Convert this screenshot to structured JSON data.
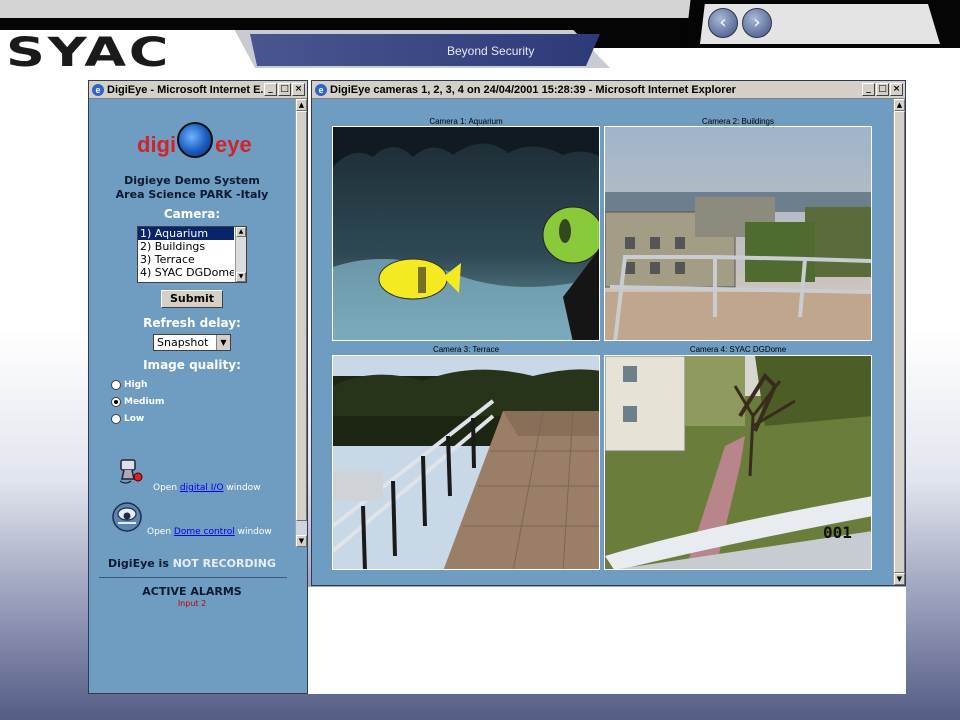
{
  "header": {
    "logo": "SYAC",
    "slogan": "Beyond Security",
    "nav": {
      "prev": "‹",
      "next": "›"
    }
  },
  "left_window": {
    "title": "DigiEye - Microsoft Internet E...",
    "logo_left": "digi",
    "logo_right": "eye",
    "system_line1": "Digieye Demo System",
    "system_line2": "Area Science PARK -Italy",
    "camera_label": "Camera:",
    "cameras": [
      "1) Aquarium",
      "2) Buildings",
      "3) Terrace",
      "4) SYAC DGDome"
    ],
    "submit_label": "Submit",
    "refresh_label": "Refresh delay:",
    "refresh_value": "Snapshot",
    "quality_label": "Image quality:",
    "quality_options": [
      "High",
      "Medium",
      "Low"
    ],
    "quality_selected": "Medium",
    "io_open": "Open",
    "io_link": "digital I/O",
    "io_window": "window",
    "dome_open": "Open",
    "dome_link": "Dome control",
    "dome_window": "window",
    "recording_prefix": "DigiEye is",
    "recording_status": "NOT RECORDING",
    "alarms_title": "ACTIVE ALARMS",
    "alarm_item": "Input 2",
    "colors": {
      "panel_bg": "#6f9cc1",
      "alarm": "#c00000"
    }
  },
  "camera_window": {
    "title": "DigiEye cameras 1, 2, 3, 4 on 24/04/2001 15:28:39 - Microsoft Internet Explorer",
    "cameras": [
      {
        "caption": "Camera 1: Aquarium"
      },
      {
        "caption": "Camera 2: Buildings"
      },
      {
        "caption": "Camera 3: Terrace"
      },
      {
        "caption": "Camera 4: SYAC DGDome",
        "overlay": "001"
      }
    ]
  }
}
